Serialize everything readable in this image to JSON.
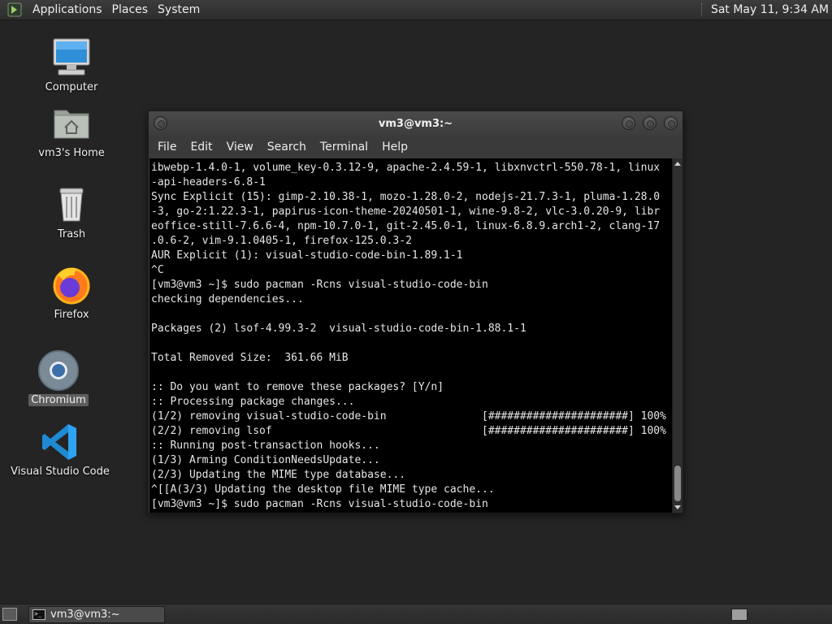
{
  "top_panel": {
    "menus": [
      "Applications",
      "Places",
      "System"
    ],
    "clock": "Sat May 11,  9:34 AM"
  },
  "desktop_icons": [
    {
      "label": "Computer",
      "icon": "computer-icon"
    },
    {
      "label": "vm3's Home",
      "icon": "home-folder-icon"
    },
    {
      "label": "Trash",
      "icon": "trash-icon"
    },
    {
      "label": "Firefox",
      "icon": "firefox-icon"
    },
    {
      "label": "Chromium",
      "icon": "chromium-icon",
      "selected": true
    },
    {
      "label": "Visual Studio Code",
      "icon": "vscode-icon"
    }
  ],
  "terminal": {
    "title": "vm3@vm3:~",
    "menus": [
      "File",
      "Edit",
      "View",
      "Search",
      "Terminal",
      "Help"
    ],
    "lines": [
      "ibwebp-1.4.0-1, volume_key-0.3.12-9, apache-2.4.59-1, libxnvctrl-550.78-1, linux",
      "-api-headers-6.8-1",
      "Sync Explicit (15): gimp-2.10.38-1, mozo-1.28.0-2, nodejs-21.7.3-1, pluma-1.28.0",
      "-3, go-2:1.22.3-1, papirus-icon-theme-20240501-1, wine-9.8-2, vlc-3.0.20-9, libr",
      "eoffice-still-7.6.6-4, npm-10.7.0-1, git-2.45.0-1, linux-6.8.9.arch1-2, clang-17",
      ".0.6-2, vim-9.1.0405-1, firefox-125.0.3-2",
      "AUR Explicit (1): visual-studio-code-bin-1.89.1-1",
      "^C",
      "[vm3@vm3 ~]$ sudo pacman -Rcns visual-studio-code-bin",
      "checking dependencies...",
      "",
      "Packages (2) lsof-4.99.3-2  visual-studio-code-bin-1.88.1-1",
      "",
      "Total Removed Size:  361.66 MiB",
      "",
      ":: Do you want to remove these packages? [Y/n]",
      ":: Processing package changes...",
      "(1/2) removing visual-studio-code-bin               [######################] 100%",
      "(2/2) removing lsof                                 [######################] 100%",
      ":: Running post-transaction hooks...",
      "(1/3) Arming ConditionNeedsUpdate...",
      "(2/3) Updating the MIME type database...",
      "^[[A(3/3) Updating the desktop file MIME type cache...",
      "[vm3@vm3 ~]$ sudo pacman -Rcns visual-studio-code-bin"
    ]
  },
  "taskbar": {
    "task_label": "vm3@vm3:~"
  }
}
